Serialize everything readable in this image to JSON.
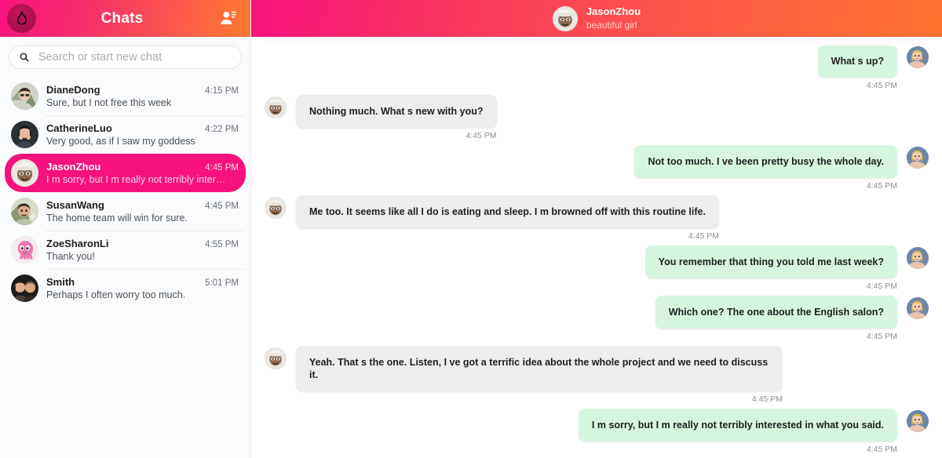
{
  "sidebar": {
    "header": {
      "title": "Chats",
      "logo_icon": "flame-icon",
      "add_contact_icon": "add-contact-icon",
      "gradient_from": "#f7117d",
      "gradient_to": "#fe7a32"
    },
    "search": {
      "placeholder": "Search or start new chat",
      "value": "",
      "icon": "search-icon"
    },
    "active_color": "#f7117d",
    "items": [
      {
        "name": "DianeDong",
        "time": "4:15 PM",
        "preview": "Sure, but I not free this week",
        "active": false,
        "avatar": "woman-glasses-avatar"
      },
      {
        "name": "CatherineLuo",
        "time": "4:22 PM",
        "preview": "Very good, as if I saw my goddess",
        "active": false,
        "avatar": "woman-dark-avatar"
      },
      {
        "name": "JasonZhou",
        "time": "4:45 PM",
        "preview": "I m sorry, but I m really not terribly inter…",
        "active": true,
        "avatar": "man-cap-avatar"
      },
      {
        "name": "SusanWang",
        "time": "4:45 PM",
        "preview": "The home team will win for sure.",
        "active": false,
        "avatar": "person-green-avatar"
      },
      {
        "name": "ZoeSharonLi",
        "time": "4:55 PM",
        "preview": "Thank you!",
        "active": false,
        "avatar": "pink-octopus-avatar"
      },
      {
        "name": "Smith",
        "time": "5:01 PM",
        "preview": "Perhaps I often worry too much.",
        "active": false,
        "avatar": "couple-avatar"
      }
    ]
  },
  "chat": {
    "header": {
      "name": "JasonZhou",
      "status": "beautiful girl",
      "avatar": "man-cap-avatar"
    },
    "bubble_in_color": "#ededed",
    "bubble_out_color": "#d6f5df",
    "messages": [
      {
        "direction": "outgoing",
        "text": "What s up?",
        "time": "4:45 PM",
        "avatar": "blonde-woman-avatar"
      },
      {
        "direction": "incoming",
        "text": "Nothing much. What s new with you?",
        "time": "4:45 PM",
        "avatar": "man-cap-avatar"
      },
      {
        "direction": "outgoing",
        "text": "Not too much. I ve been pretty busy the whole day.",
        "time": "4:45 PM",
        "avatar": "blonde-woman-avatar"
      },
      {
        "direction": "incoming",
        "text": "Me too. It seems like all I do is eating and sleep. I m browned off with this routine life.",
        "time": "4:45 PM",
        "avatar": "man-cap-avatar"
      },
      {
        "direction": "outgoing",
        "text": "You remember that thing you told me last week?",
        "time": "4:45 PM",
        "avatar": "blonde-woman-avatar"
      },
      {
        "direction": "outgoing",
        "text": "Which one? The one about the English salon?",
        "time": "4:45 PM",
        "avatar": "blonde-woman-avatar"
      },
      {
        "direction": "incoming",
        "text": "Yeah. That s the one. Listen, I ve got a terrific idea about the whole project and we need to discuss it.",
        "time": "4:45 PM",
        "avatar": "man-cap-avatar"
      },
      {
        "direction": "outgoing",
        "text": "I m sorry, but I m really not terribly interested in what you said.",
        "time": "4:45 PM",
        "avatar": "blonde-woman-avatar"
      }
    ]
  }
}
